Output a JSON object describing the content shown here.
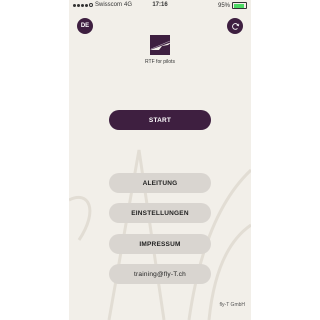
{
  "status_bar": {
    "carrier": "Swisscom",
    "network": "4G",
    "time": "17:16",
    "battery": "95%",
    "battery_level": 0.95
  },
  "header": {
    "language_button": "DE",
    "sync_icon": "refresh-icon"
  },
  "brand": {
    "logo_icon": "plane-logo-icon",
    "name": "RTF for pilots"
  },
  "menu": {
    "start": "START",
    "items": [
      "ALEITUNG",
      "EINSTELLUNGEN",
      "IMPRESSUM",
      "training@fly-T.ch"
    ]
  },
  "footer": {
    "company": "fly-T GmbH"
  },
  "colors": {
    "accent": "#3e1f40",
    "background": "#f2efe9",
    "secondary_button": "#d9d5d0"
  }
}
